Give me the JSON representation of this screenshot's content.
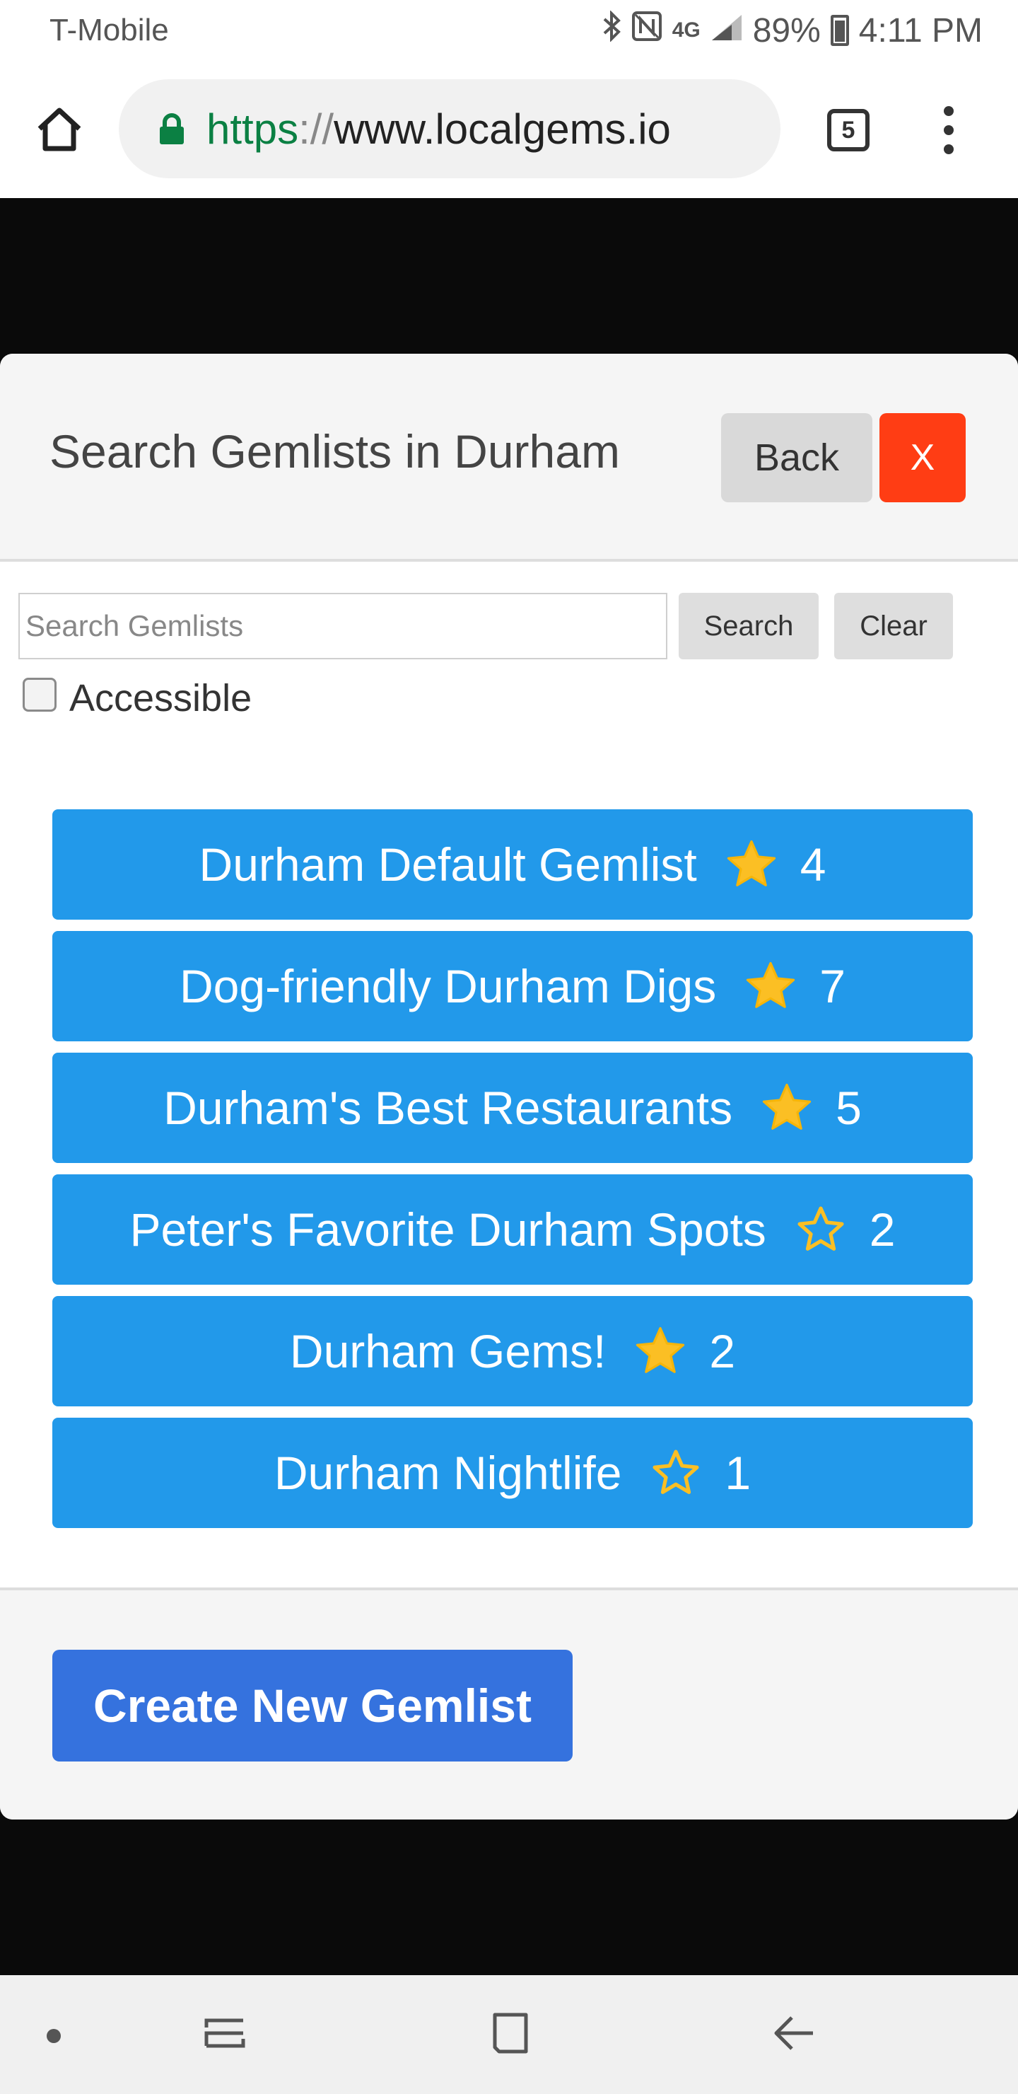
{
  "status_bar": {
    "carrier": "T-Mobile",
    "network": "4G",
    "battery": "89%",
    "time": "4:11 PM"
  },
  "browser": {
    "url_scheme": "https",
    "url_separator": "://",
    "url_host": "www.localgems.io",
    "tab_count": "5"
  },
  "modal": {
    "title": "Search Gemlists in Durham",
    "back_label": "Back",
    "close_label": "X",
    "search_placeholder": "Search Gemlists",
    "search_value": "",
    "search_label": "Search",
    "clear_label": "Clear",
    "accessible_label": "Accessible",
    "accessible_checked": false,
    "gemlists": [
      {
        "name": "Durham Default Gemlist",
        "starred": true,
        "count": "4"
      },
      {
        "name": "Dog-friendly Durham Digs",
        "starred": true,
        "count": "7"
      },
      {
        "name": "Durham's Best Restaurants",
        "starred": true,
        "count": "5"
      },
      {
        "name": "Peter's Favorite Durham Spots",
        "starred": false,
        "count": "2"
      },
      {
        "name": "Durham Gems!",
        "starred": true,
        "count": "2"
      },
      {
        "name": "Durham Nightlife",
        "starred": false,
        "count": "1"
      }
    ],
    "create_label": "Create New Gemlist"
  },
  "colors": {
    "gem_item_bg": "#2299ea",
    "star_fill": "#fbbf24",
    "close_bg": "#ff3d14",
    "create_bg": "#3572de",
    "url_scheme": "#0b8043"
  }
}
